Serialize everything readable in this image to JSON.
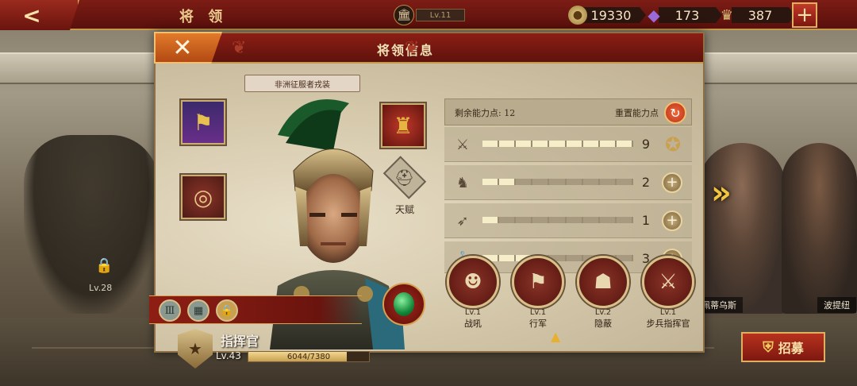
{
  "topbar": {
    "title": "将 领",
    "level": "Lv.11",
    "resources": {
      "gold": "19330",
      "gems": "173",
      "population": "387"
    },
    "icons": {
      "back": "back-arrow-icon",
      "level": "temple-icon",
      "gold": "coin-icon",
      "gems": "crystal-icon",
      "population": "crown-icon",
      "add": "plus-icon"
    }
  },
  "dialog": {
    "title": "将领信息",
    "outfit": "非洲征服者戎装",
    "talent_label": "天赋",
    "general": {
      "rank": "指挥官",
      "level": "Lv.43",
      "xp": "6044/7380",
      "xp_progress": 0.819
    },
    "stats": {
      "remaining_label": "剩余能力点: 12",
      "reset_label": "重置能力点",
      "rows": [
        {
          "icon": "sword-icon",
          "value": "9",
          "progress": 9,
          "max": 9,
          "action": "medal-icon"
        },
        {
          "icon": "horse-icon",
          "value": "2",
          "progress": 2,
          "max": 9,
          "action": "plus-icon"
        },
        {
          "icon": "bow-icon",
          "value": "1",
          "progress": 1,
          "max": 9,
          "action": "plus-icon"
        },
        {
          "icon": "anchor-icon",
          "value": "3",
          "progress": 3,
          "max": 9,
          "action": "plus-icon"
        }
      ]
    },
    "skills": [
      {
        "level": "Lv.1",
        "name": "战吼",
        "icon": "warcry-icon"
      },
      {
        "level": "Lv.1",
        "name": "行军",
        "icon": "march-icon"
      },
      {
        "level": "Lv.2",
        "name": "隐蔽",
        "icon": "conceal-icon"
      },
      {
        "level": "Lv.1",
        "name": "步兵指挥官",
        "icon": "crossed-swords-icon"
      }
    ]
  },
  "background": {
    "locked_level": "Lv.28",
    "characters": [
      "佩蒂乌斯",
      "波提纽"
    ]
  },
  "recruit_label": "招募",
  "colors": {
    "accent_red": "#7c1c15",
    "gold": "#d4a450",
    "parchment": "#d9cfb6"
  }
}
